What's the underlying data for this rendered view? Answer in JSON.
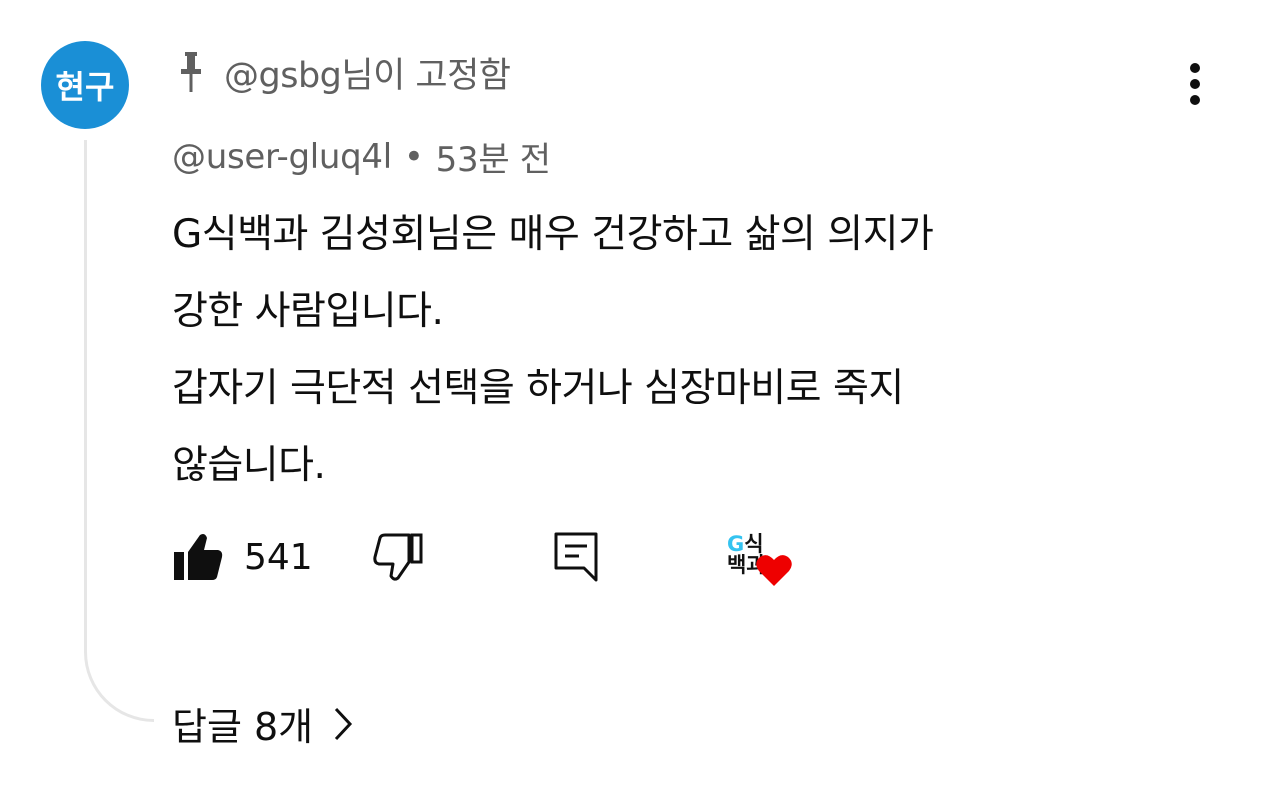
{
  "avatar": {
    "text": "현구",
    "color": "#1a8fd6"
  },
  "pinned": {
    "icon": "pin-icon",
    "text": "@gsbg님이 고정함"
  },
  "comment": {
    "author": "@user-gluq4l",
    "separator": "•",
    "time": "53분 전",
    "lines": [
      "G식백과 김성회님은 매우 건강하고 삶의 의지가",
      "강한 사람입니다.",
      "갑자기 극단적 선택을 하거나 심장마비로 죽지",
      "않습니다."
    ]
  },
  "actions": {
    "like_icon": "thumbs-up-filled-icon",
    "like_count": "541",
    "dislike_icon": "thumbs-down-icon",
    "reply_icon": "reply-comment-icon",
    "creator_heart": {
      "logo_text_g": "G",
      "logo_text_line1": "식",
      "logo_text_line2": "백과",
      "heart_color": "#ee0000"
    }
  },
  "replies": {
    "label": "답글 8개",
    "chevron_icon": "chevron-right-icon"
  },
  "menu": {
    "icon": "more-vertical-icon"
  }
}
